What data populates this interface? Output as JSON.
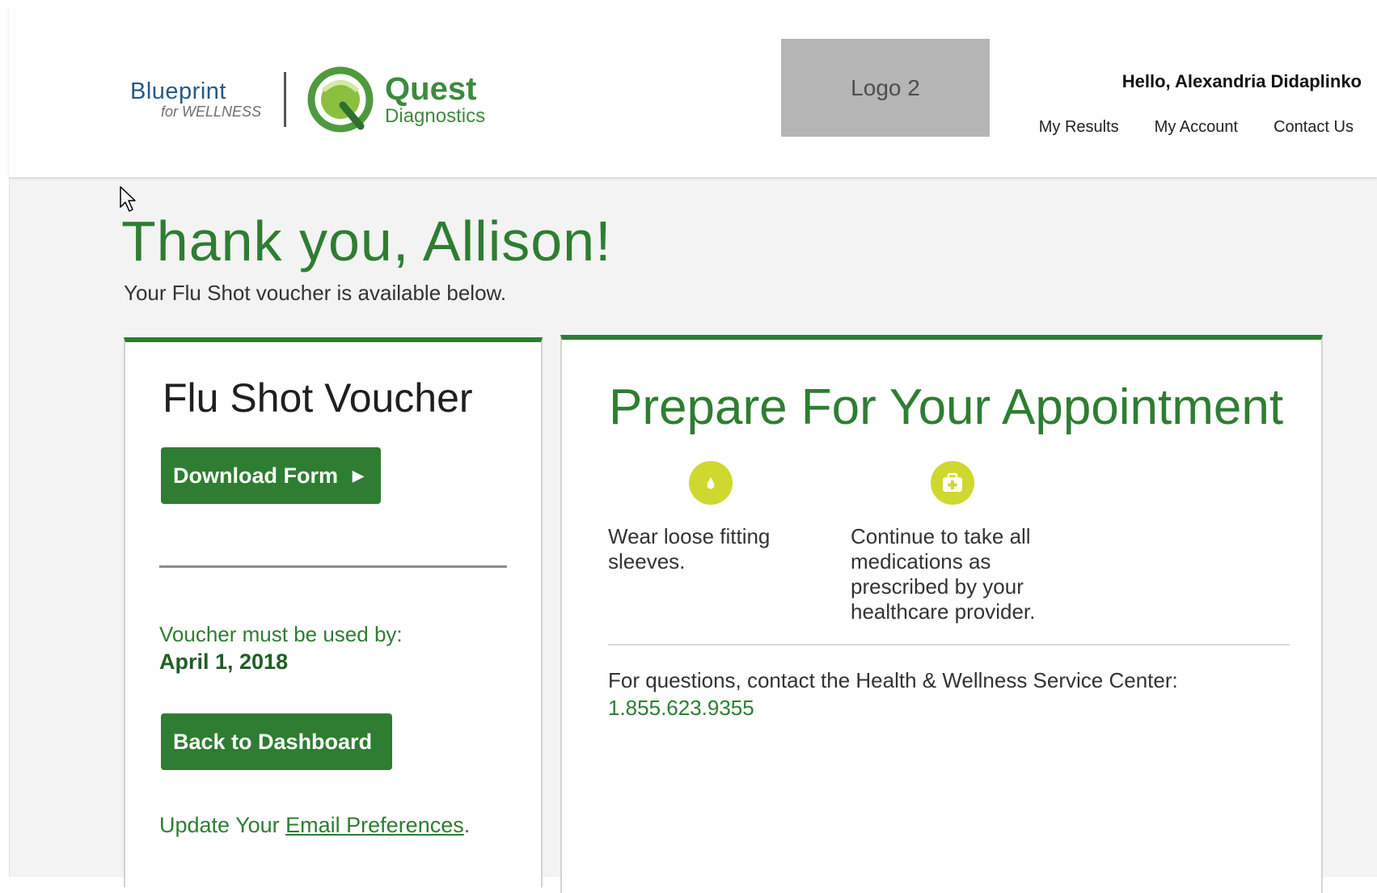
{
  "header": {
    "brand_main": "Blueprint",
    "brand_sub": "for WELLNESS",
    "partner_main": "Quest",
    "partner_sub": "Diagnostics",
    "logo2_label": "Logo 2",
    "greeting": "Hello, Alexandria Didaplinko",
    "nav": [
      "My Results",
      "My Account",
      "Contact Us"
    ]
  },
  "page": {
    "title": "Thank you, Allison!",
    "subtitle": "Your Flu Shot voucher is available below."
  },
  "voucher_card": {
    "title": "Flu Shot Voucher",
    "download_label": "Download Form",
    "must_use_label": "Voucher must be used by:",
    "must_use_date": "April 1, 2018",
    "back_label": "Back to Dashboard",
    "email_prefix": "Update Your ",
    "email_link": "Email Preferences",
    "email_suffix": "."
  },
  "prepare_card": {
    "title": "Prepare For Your Appointment",
    "tips": [
      {
        "icon": "drop-icon",
        "text": "Wear loose fitting sleeves."
      },
      {
        "icon": "medical-kit-icon",
        "text": "Continue to take all medications as prescribed by your healthcare provider."
      }
    ],
    "questions_text": "For questions, contact the Health & Wellness Service Center:",
    "phone": "1.855.623.9355"
  },
  "colors": {
    "accent": "#2e7d32",
    "icon_bg": "#cfd82e",
    "brand_blue": "#235a8a",
    "logo_placeholder": "#b5b5b5"
  }
}
